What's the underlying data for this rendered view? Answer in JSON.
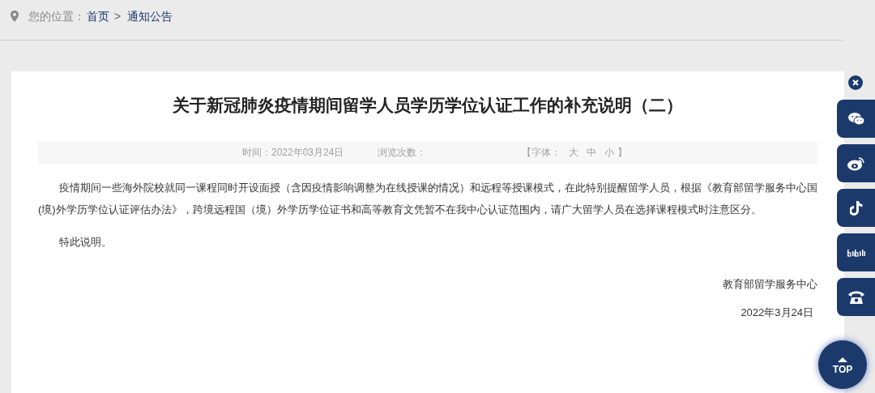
{
  "breadcrumb": {
    "label": "您的位置：",
    "links": [
      "首页",
      "通知公告"
    ],
    "separator": ">"
  },
  "article": {
    "title": "关于新冠肺炎疫情期间留学人员学历学位认证工作的补充说明（二）",
    "meta": {
      "time": "时间：2022年03月24日",
      "views": "浏览次数：",
      "font_label": "【字体：",
      "font_sizes": [
        "大",
        "中",
        "小"
      ],
      "font_end": "】"
    },
    "paragraphs": [
      "疫情期间一些海外院校就同一课程同时开设面授（含因疫情影响调整为在线授课的情况）和远程等授课模式，在此特别提醒留学人员，根据《教育部留学服务中心国(境)外学历学位认证评估办法》，跨境远程国（境）外学历学位证书和高等教育文凭暂不在我中心认证范围内，请广大留学人员在选择课程模式时注意区分。",
      "特此说明。"
    ],
    "signature": "教育部留学服务中心",
    "date": "2022年3月24日"
  },
  "side_buttons": [
    {
      "kind": "wechat"
    },
    {
      "kind": "weibo"
    },
    {
      "kind": "tiktok"
    },
    {
      "kind": "bilibili"
    },
    {
      "kind": "phone"
    }
  ],
  "top_button": "TOP"
}
